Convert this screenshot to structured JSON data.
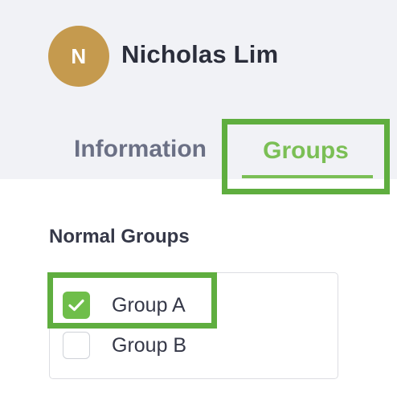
{
  "user": {
    "initial": "N",
    "name": "Nicholas Lim",
    "avatar_color": "#c59a4e"
  },
  "tabs": [
    {
      "label": "Information",
      "active": false
    },
    {
      "label": "Groups",
      "active": true
    }
  ],
  "section": {
    "title": "Normal Groups",
    "groups": [
      {
        "label": "Group A",
        "checked": true,
        "highlighted": true
      },
      {
        "label": "Group B",
        "checked": false,
        "highlighted": false
      }
    ]
  },
  "colors": {
    "accent_green": "#7bbf55",
    "highlight_green": "#5fae3f",
    "header_bg": "#f1f2f6",
    "text_dark": "#2b2e3b",
    "tab_inactive": "#6b7085"
  },
  "icons": {
    "checkmark": "check-icon"
  }
}
